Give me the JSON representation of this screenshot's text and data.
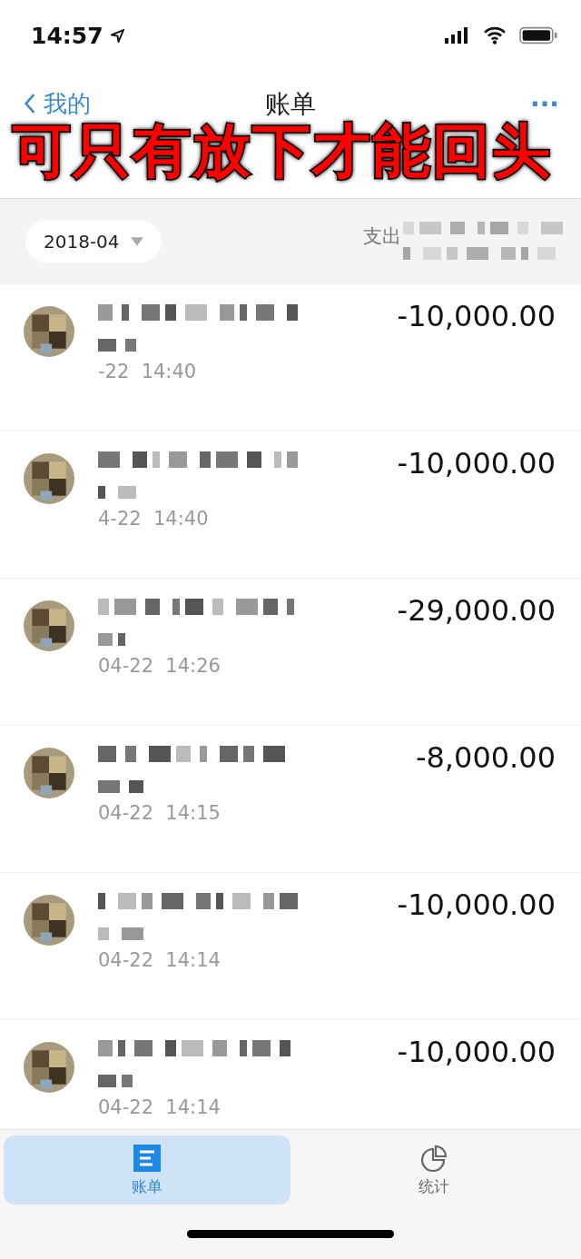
{
  "status_bar": {
    "time": "14:57"
  },
  "nav": {
    "back": "我的",
    "title": "账单",
    "more": "···"
  },
  "caption": "可只有放下才能回头",
  "filter": {
    "month": "2018-04",
    "summary_label": "支出"
  },
  "rows": [
    {
      "amount": "-10,000.00",
      "time": "-22  14:40"
    },
    {
      "amount": "-10,000.00",
      "time": "4-22  14:40"
    },
    {
      "amount": "-29,000.00",
      "time": "04-22  14:26"
    },
    {
      "amount": "-8,000.00",
      "time": "04-22  14:15"
    },
    {
      "amount": "-10,000.00",
      "time": "04-22  14:14"
    },
    {
      "amount": "-10,000.00",
      "time": "04-22  14:14"
    }
  ],
  "tabs": [
    {
      "label": "账单",
      "kind": "bill",
      "selected": true
    },
    {
      "label": "统计",
      "kind": "stats",
      "selected": false
    }
  ]
}
